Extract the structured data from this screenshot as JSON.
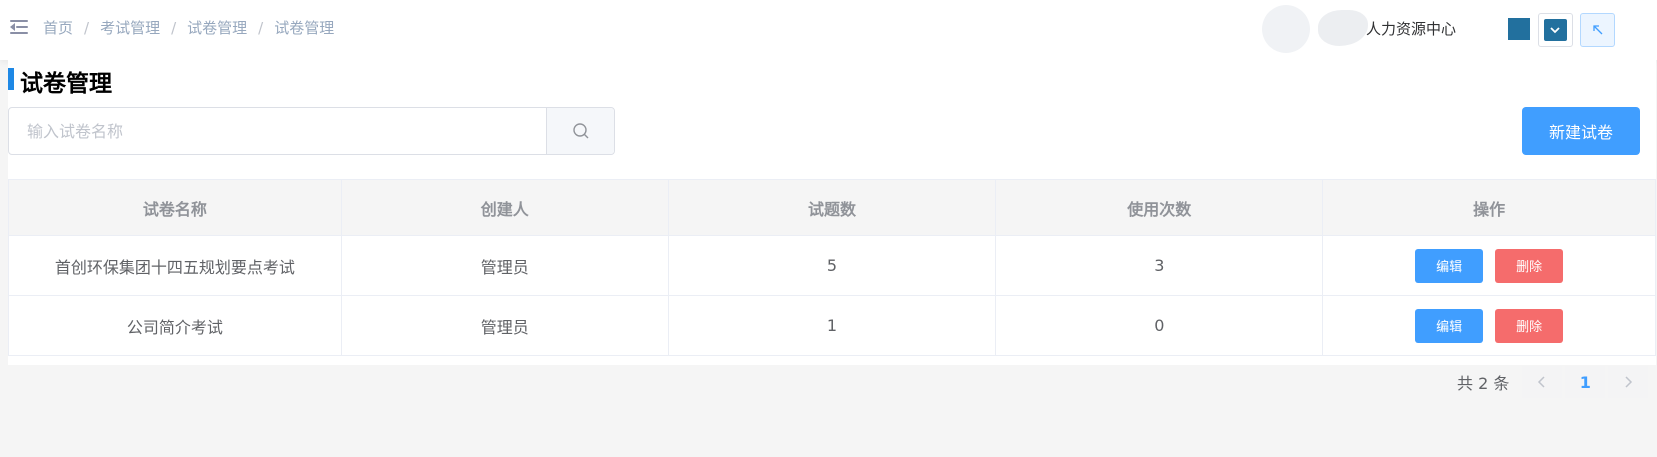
{
  "header": {
    "breadcrumb": [
      "首页",
      "考试管理",
      "试卷管理",
      "试卷管理"
    ],
    "separator": "/",
    "org_name": "人力资源中心",
    "theme_color": "#22709e"
  },
  "page": {
    "title": "试卷管理"
  },
  "search": {
    "placeholder": "输入试卷名称",
    "value": ""
  },
  "actions": {
    "new_label": "新建试卷"
  },
  "table": {
    "columns": [
      "试卷名称",
      "创建人",
      "试题数",
      "使用次数",
      "操作"
    ],
    "rows": [
      {
        "name": "首创环保集团十四五规划要点考试",
        "creator": "管理员",
        "questions": "5",
        "uses": "3",
        "edit": "编辑",
        "delete": "删除"
      },
      {
        "name": "公司简介考试",
        "creator": "管理员",
        "questions": "1",
        "uses": "0",
        "edit": "编辑",
        "delete": "删除"
      }
    ]
  },
  "pagination": {
    "total_label": "共 2 条",
    "current_page": "1"
  },
  "colors": {
    "primary": "#409eff",
    "danger": "#f56c6c",
    "title_accent": "#1e88e5"
  }
}
